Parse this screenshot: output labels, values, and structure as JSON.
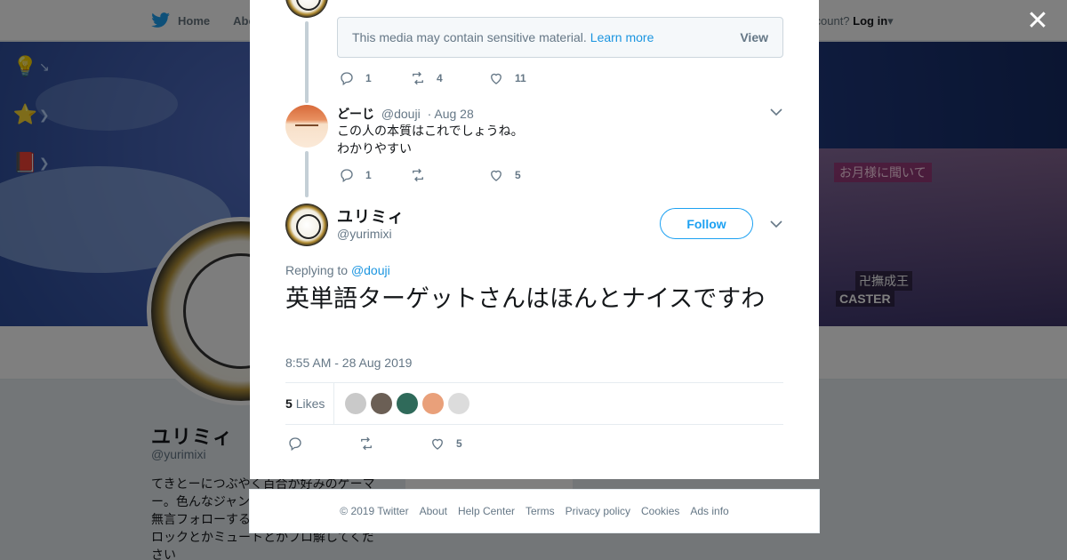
{
  "topbar": {
    "home_label": "Home",
    "about_label": "Abo",
    "account_prompt": "ccount?",
    "login_label": "Log in"
  },
  "banner": {
    "tag_1": "お月様に聞いて",
    "tag_2": "卍撫成王",
    "tag_3": "CASTER"
  },
  "profile": {
    "name": "ユリミィ",
    "handle": "@yurimixi",
    "bio_lines": [
      "てきとーにつぶやく百合が好みのゲーマ",
      "ー。色んなジャン",
      "無言フォローする",
      "ロックとかミュートとかブロ解してくだ",
      "さい"
    ]
  },
  "thread": {
    "prev_tweet": {
      "sensitive_text": "This media may contain sensitive material.",
      "learn_more": "Learn more",
      "view_label": "View",
      "replies": "1",
      "retweets": "4",
      "likes": "11"
    },
    "reply_tweet": {
      "display_name": "どーじ",
      "handle": "@douji",
      "date": "· Aug 28",
      "lines": [
        "この人の本質はこれでしょうね。",
        "わかりやすい"
      ],
      "replies": "1",
      "retweets": "",
      "likes": "5"
    },
    "main_tweet": {
      "display_name": "ユリミィ",
      "handle": "@yurimixi",
      "follow_label": "Follow",
      "replying_prefix": "Replying to",
      "replying_to": "@douji",
      "text": "英単語ターゲットさんはほんとナイスですわ",
      "timestamp": "8:55 AM - 28 Aug 2019",
      "likes_count": "5",
      "likes_label": "Likes",
      "likers": [
        "#c9c9c9",
        "#6b5f55",
        "#2f6a5a",
        "#e9a07a",
        "#dcdcdc"
      ],
      "like_total": "5"
    }
  },
  "footer": {
    "links": [
      "© 2019 Twitter",
      "About",
      "Help Center",
      "Terms",
      "Privacy policy",
      "Cookies",
      "Ads info"
    ]
  },
  "colors": {
    "accent": "#1da1f2",
    "link": "#1b95e0",
    "muted": "#657786"
  }
}
